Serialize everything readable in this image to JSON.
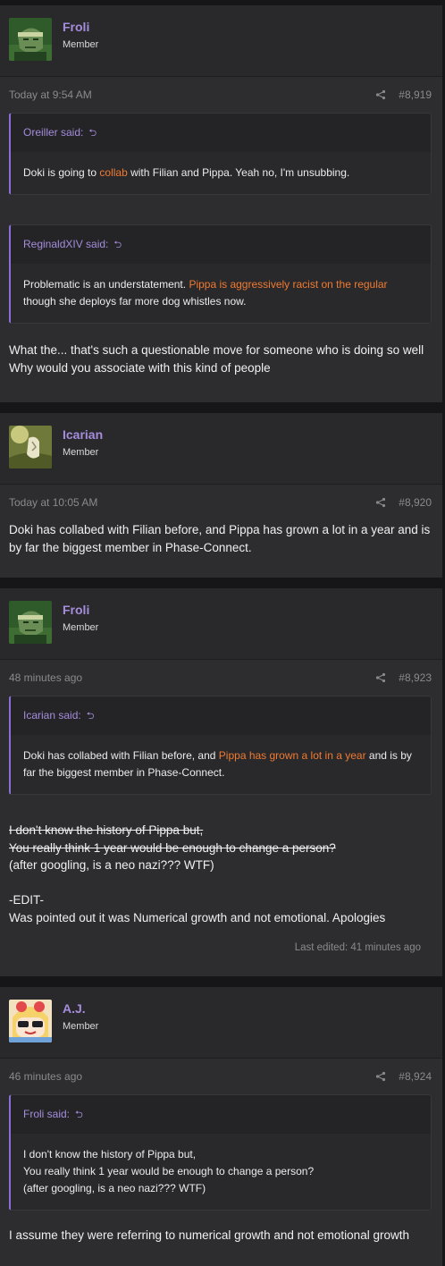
{
  "posts": [
    {
      "author": "Froli",
      "title": "Member",
      "avatar": "froli-avatar",
      "time": "Today at 9:54 AM",
      "number": "#8,919",
      "quotes": [
        {
          "author": "Oreiller said:",
          "parts": [
            [
              "Doki is going to ",
              false
            ],
            [
              "collab",
              true
            ],
            [
              " with Filian and Pippa. Yeah no, I'm unsubbing.",
              false
            ]
          ]
        },
        {
          "author": "ReginaldXIV said:",
          "parts": [
            [
              "Problematic is an understatement. ",
              false
            ],
            [
              "Pippa is aggressively racist on the regular",
              true
            ],
            [
              " though she deploys far more dog whistles now.",
              false
            ]
          ]
        }
      ],
      "message": [
        "What the... that's such a questionable move for someone who is doing so well",
        "Why would you associate with this kind of people"
      ]
    },
    {
      "author": "Icarian",
      "title": "Member",
      "avatar": "icarian-avatar",
      "time": "Today at 10:05 AM",
      "number": "#8,920",
      "quotes": [],
      "message": [
        "Doki has collabed with Filian before, and Pippa has grown a lot in a year and is by far the biggest member in Phase-Connect."
      ]
    },
    {
      "author": "Froli",
      "title": "Member",
      "avatar": "froli-avatar",
      "time": "48 minutes ago",
      "number": "#8,923",
      "quotes": [
        {
          "author": "Icarian said:",
          "parts": [
            [
              "Doki has collabed with Filian before, and ",
              false
            ],
            [
              "Pippa has grown a lot in a year",
              true
            ],
            [
              " and is by far the biggest member in Phase-Connect.",
              false
            ]
          ]
        }
      ],
      "message_struck": [
        "I don't know the history of Pippa but,",
        "You really think 1 year would be enough to change a person?"
      ],
      "message": [
        "(after googling, is a neo nazi??? WTF)",
        "",
        "-EDIT-",
        "Was pointed out it was Numerical growth and not emotional. Apologies"
      ],
      "edited": "Last edited: 41 minutes ago"
    },
    {
      "author": "A.J.",
      "title": "Member",
      "avatar": "aj-avatar",
      "time": "46 minutes ago",
      "number": "#8,924",
      "quotes": [
        {
          "author": "Froli said:",
          "parts": [
            [
              "I don't know the history of Pippa but,\nYou really think 1 year would be enough to change a person?\n(after googling, is a neo nazi??? WTF)",
              false
            ]
          ]
        }
      ],
      "message": [
        "I assume they were referring to numerical growth and not emotional growth"
      ]
    }
  ],
  "colors": {
    "accent": "#a58ddc",
    "highlight": "#f07a31"
  }
}
